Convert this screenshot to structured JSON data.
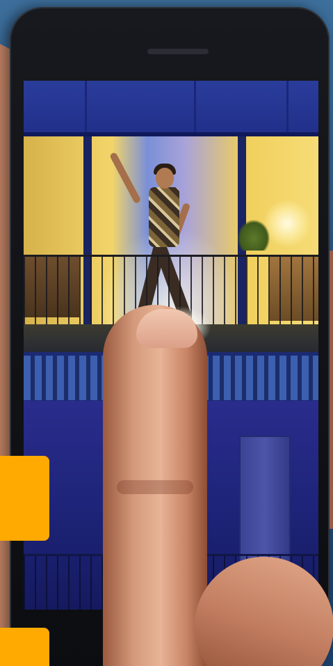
{
  "image": {
    "colors": {
      "accent": "#ffaa00",
      "sky": "#2b5784",
      "phone_body": "#0c0d10",
      "lit_room": "#f2d56a",
      "dark_room": "#1e2479"
    },
    "icons": [
      "phone-speaker-icon"
    ]
  }
}
